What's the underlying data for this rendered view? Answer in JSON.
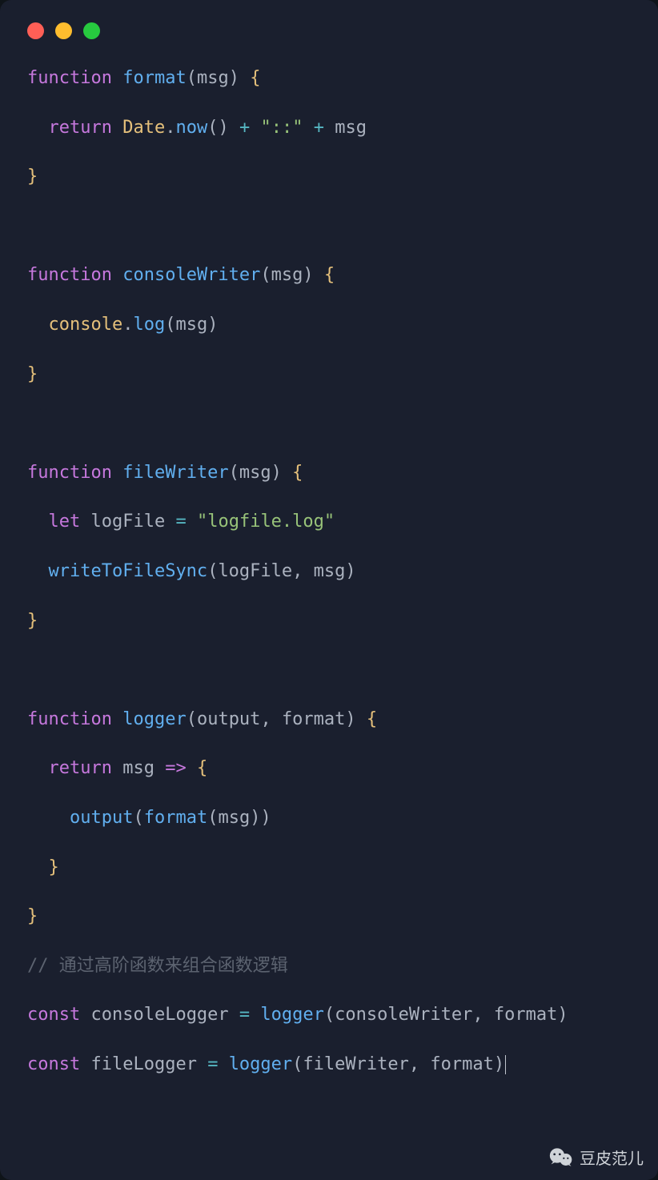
{
  "code": {
    "lines": [
      {
        "segments": [
          {
            "cls": "kw",
            "t": "function"
          },
          {
            "cls": "punct",
            "t": " "
          },
          {
            "cls": "fn-def",
            "t": "format"
          },
          {
            "cls": "punct",
            "t": "("
          },
          {
            "cls": "param",
            "t": "msg"
          },
          {
            "cls": "punct",
            "t": ") "
          },
          {
            "cls": "brace",
            "t": "{"
          }
        ]
      },
      {
        "segments": []
      },
      {
        "segments": [
          {
            "cls": "punct",
            "t": "  "
          },
          {
            "cls": "kw",
            "t": "return"
          },
          {
            "cls": "punct",
            "t": " "
          },
          {
            "cls": "obj",
            "t": "Date"
          },
          {
            "cls": "punct",
            "t": "."
          },
          {
            "cls": "prop",
            "t": "now"
          },
          {
            "cls": "punct",
            "t": "() "
          },
          {
            "cls": "op",
            "t": "+"
          },
          {
            "cls": "punct",
            "t": " "
          },
          {
            "cls": "str",
            "t": "\"::\""
          },
          {
            "cls": "punct",
            "t": " "
          },
          {
            "cls": "op",
            "t": "+"
          },
          {
            "cls": "punct",
            "t": " "
          },
          {
            "cls": "param",
            "t": "msg"
          }
        ]
      },
      {
        "segments": []
      },
      {
        "segments": [
          {
            "cls": "brace",
            "t": "}"
          }
        ]
      },
      {
        "segments": []
      },
      {
        "segments": []
      },
      {
        "segments": []
      },
      {
        "segments": [
          {
            "cls": "kw",
            "t": "function"
          },
          {
            "cls": "punct",
            "t": " "
          },
          {
            "cls": "fn-def",
            "t": "consoleWriter"
          },
          {
            "cls": "punct",
            "t": "("
          },
          {
            "cls": "param",
            "t": "msg"
          },
          {
            "cls": "punct",
            "t": ") "
          },
          {
            "cls": "brace",
            "t": "{"
          }
        ]
      },
      {
        "segments": []
      },
      {
        "segments": [
          {
            "cls": "punct",
            "t": "  "
          },
          {
            "cls": "obj",
            "t": "console"
          },
          {
            "cls": "punct",
            "t": "."
          },
          {
            "cls": "prop",
            "t": "log"
          },
          {
            "cls": "punct",
            "t": "("
          },
          {
            "cls": "param",
            "t": "msg"
          },
          {
            "cls": "punct",
            "t": ")"
          }
        ]
      },
      {
        "segments": []
      },
      {
        "segments": [
          {
            "cls": "brace",
            "t": "}"
          }
        ]
      },
      {
        "segments": []
      },
      {
        "segments": []
      },
      {
        "segments": []
      },
      {
        "segments": [
          {
            "cls": "kw",
            "t": "function"
          },
          {
            "cls": "punct",
            "t": " "
          },
          {
            "cls": "fn-def",
            "t": "fileWriter"
          },
          {
            "cls": "punct",
            "t": "("
          },
          {
            "cls": "param",
            "t": "msg"
          },
          {
            "cls": "punct",
            "t": ") "
          },
          {
            "cls": "brace",
            "t": "{"
          }
        ]
      },
      {
        "segments": []
      },
      {
        "segments": [
          {
            "cls": "punct",
            "t": "  "
          },
          {
            "cls": "kw",
            "t": "let"
          },
          {
            "cls": "punct",
            "t": " "
          },
          {
            "cls": "param",
            "t": "logFile"
          },
          {
            "cls": "punct",
            "t": " "
          },
          {
            "cls": "op",
            "t": "="
          },
          {
            "cls": "punct",
            "t": " "
          },
          {
            "cls": "str",
            "t": "\"logfile.log\""
          }
        ]
      },
      {
        "segments": []
      },
      {
        "segments": [
          {
            "cls": "punct",
            "t": "  "
          },
          {
            "cls": "fn-call",
            "t": "writeToFileSync"
          },
          {
            "cls": "punct",
            "t": "("
          },
          {
            "cls": "param",
            "t": "logFile"
          },
          {
            "cls": "punct",
            "t": ", "
          },
          {
            "cls": "param",
            "t": "msg"
          },
          {
            "cls": "punct",
            "t": ")"
          }
        ]
      },
      {
        "segments": []
      },
      {
        "segments": [
          {
            "cls": "brace",
            "t": "}"
          }
        ]
      },
      {
        "segments": []
      },
      {
        "segments": []
      },
      {
        "segments": []
      },
      {
        "segments": [
          {
            "cls": "kw",
            "t": "function"
          },
          {
            "cls": "punct",
            "t": " "
          },
          {
            "cls": "fn-def",
            "t": "logger"
          },
          {
            "cls": "punct",
            "t": "("
          },
          {
            "cls": "param",
            "t": "output"
          },
          {
            "cls": "punct",
            "t": ", "
          },
          {
            "cls": "param",
            "t": "format"
          },
          {
            "cls": "punct",
            "t": ") "
          },
          {
            "cls": "brace",
            "t": "{"
          }
        ]
      },
      {
        "segments": []
      },
      {
        "segments": [
          {
            "cls": "punct",
            "t": "  "
          },
          {
            "cls": "kw",
            "t": "return"
          },
          {
            "cls": "punct",
            "t": " "
          },
          {
            "cls": "param",
            "t": "msg"
          },
          {
            "cls": "punct",
            "t": " "
          },
          {
            "cls": "arrow",
            "t": "=>"
          },
          {
            "cls": "punct",
            "t": " "
          },
          {
            "cls": "brace",
            "t": "{"
          }
        ]
      },
      {
        "segments": []
      },
      {
        "segments": [
          {
            "cls": "punct",
            "t": "    "
          },
          {
            "cls": "fn-call",
            "t": "output"
          },
          {
            "cls": "punct",
            "t": "("
          },
          {
            "cls": "fn-call",
            "t": "format"
          },
          {
            "cls": "punct",
            "t": "("
          },
          {
            "cls": "param",
            "t": "msg"
          },
          {
            "cls": "punct",
            "t": "))"
          }
        ]
      },
      {
        "segments": []
      },
      {
        "segments": [
          {
            "cls": "punct",
            "t": "  "
          },
          {
            "cls": "brace",
            "t": "}"
          }
        ]
      },
      {
        "segments": []
      },
      {
        "segments": [
          {
            "cls": "brace",
            "t": "}"
          }
        ]
      },
      {
        "segments": []
      },
      {
        "segments": [
          {
            "cls": "comment",
            "t": "// 通过高阶函数来组合函数逻辑"
          }
        ]
      },
      {
        "segments": []
      },
      {
        "segments": [
          {
            "cls": "kw",
            "t": "const"
          },
          {
            "cls": "punct",
            "t": " "
          },
          {
            "cls": "param",
            "t": "consoleLogger"
          },
          {
            "cls": "punct",
            "t": " "
          },
          {
            "cls": "op",
            "t": "="
          },
          {
            "cls": "punct",
            "t": " "
          },
          {
            "cls": "fn-call",
            "t": "logger"
          },
          {
            "cls": "punct",
            "t": "("
          },
          {
            "cls": "param",
            "t": "consoleWriter"
          },
          {
            "cls": "punct",
            "t": ", "
          },
          {
            "cls": "param",
            "t": "format"
          },
          {
            "cls": "punct",
            "t": ")"
          }
        ]
      },
      {
        "segments": []
      },
      {
        "segments": [
          {
            "cls": "kw",
            "t": "const"
          },
          {
            "cls": "punct",
            "t": " "
          },
          {
            "cls": "param",
            "t": "fileLogger"
          },
          {
            "cls": "punct",
            "t": " "
          },
          {
            "cls": "op",
            "t": "="
          },
          {
            "cls": "punct",
            "t": " "
          },
          {
            "cls": "fn-call",
            "t": "logger"
          },
          {
            "cls": "punct",
            "t": "("
          },
          {
            "cls": "param",
            "t": "fileWriter"
          },
          {
            "cls": "punct",
            "t": ", "
          },
          {
            "cls": "param",
            "t": "format"
          },
          {
            "cls": "punct",
            "t": ")"
          },
          {
            "cls": "cursor",
            "t": ""
          }
        ]
      }
    ]
  },
  "watermark": {
    "label": "豆皮范儿"
  }
}
